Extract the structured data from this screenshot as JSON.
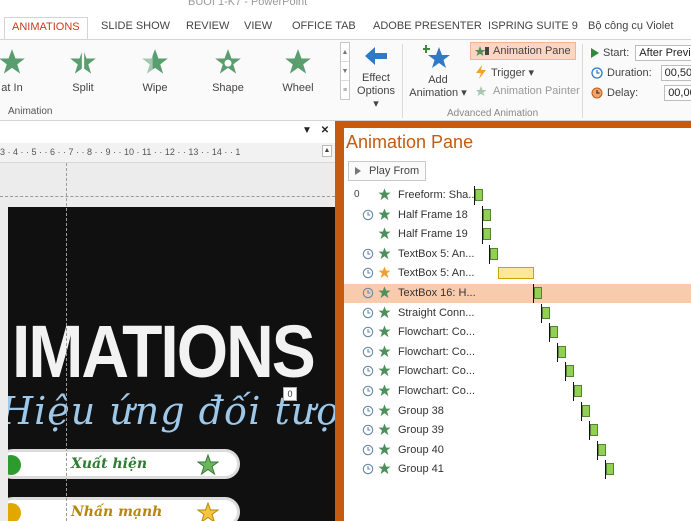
{
  "window": {
    "title": "BUOI 1-K7 - PowerPoint"
  },
  "ribbon_tabs": [
    {
      "label": "ANIMATIONS",
      "active": true
    },
    {
      "label": "SLIDE SHOW"
    },
    {
      "label": "REVIEW"
    },
    {
      "label": "VIEW"
    },
    {
      "label": "OFFICE TAB"
    },
    {
      "label": "ADOBE PRESENTER"
    },
    {
      "label": "ISPRING SUITE 9"
    },
    {
      "label": "Bộ công cụ Violet"
    }
  ],
  "animation_gallery": {
    "items": [
      {
        "label": "at In"
      },
      {
        "label": "Split"
      },
      {
        "label": "Wipe"
      },
      {
        "label": "Shape"
      },
      {
        "label": "Wheel"
      }
    ],
    "group_label": "Animation"
  },
  "effect_options": {
    "label_line1": "Effect",
    "label_line2": "Options ▾"
  },
  "add_animation": {
    "label_line1": "Add",
    "label_line2": "Animation ▾"
  },
  "advanced_animation": {
    "animation_pane": "Animation Pane",
    "trigger": "Trigger ▾",
    "animation_painter": "Animation Painter",
    "group_label": "Advanced Animation"
  },
  "timing": {
    "start_label": "Start:",
    "start_value": "After Previo",
    "duration_label": "Duration:",
    "duration_value": "00,50",
    "delay_label": "Delay:",
    "delay_value": "00,00"
  },
  "ruler": {
    "ticks": "3 · 4 · · 5 · · 6 · · 7 · · 8 · · 9 · · 10 · 11 · · 12 · · 13 · · 14 · · 1"
  },
  "slide": {
    "title": "IMATIONS",
    "subtitle": "Hiệu ứng đối tượng",
    "badge": "0",
    "pills": [
      {
        "label": "Xuất hiện",
        "color": "#2e7d32",
        "dot": "#2e9b2e"
      },
      {
        "label": "Nhấn mạnh",
        "color": "#b8860b",
        "dot": "#e0a800"
      }
    ]
  },
  "animation_pane": {
    "title": "Animation Pane",
    "play_label": "Play From",
    "items": [
      {
        "num": "0",
        "clock": false,
        "star": "#4e8f5c",
        "name": "Freeform: Sha...",
        "start": 0,
        "dur": 8,
        "selected": false
      },
      {
        "num": "",
        "clock": true,
        "star": "#4e8f5c",
        "name": "Half Frame 18",
        "start": 8,
        "dur": 8,
        "selected": false
      },
      {
        "num": "",
        "clock": false,
        "star": "#4e8f5c",
        "name": "Half Frame 19",
        "start": 8,
        "dur": 8,
        "selected": false
      },
      {
        "num": "",
        "clock": true,
        "star": "#4e8f5c",
        "name": "TextBox 5: An...",
        "start": 15,
        "dur": 8,
        "selected": false
      },
      {
        "num": "",
        "clock": true,
        "star": "#f0a030",
        "name": "TextBox 5: An...",
        "start": 23,
        "dur": 36,
        "selected": false,
        "yellow": true
      },
      {
        "num": "",
        "clock": true,
        "star": "#4e8f5c",
        "name": "TextBox 16: H...",
        "start": 59,
        "dur": 8,
        "selected": true
      },
      {
        "num": "",
        "clock": true,
        "star": "#4e8f5c",
        "name": "Straight Conn...",
        "start": 67,
        "dur": 8,
        "selected": false
      },
      {
        "num": "",
        "clock": true,
        "star": "#4e8f5c",
        "name": "Flowchart: Co...",
        "start": 75,
        "dur": 8,
        "selected": false
      },
      {
        "num": "",
        "clock": true,
        "star": "#4e8f5c",
        "name": "Flowchart: Co...",
        "start": 83,
        "dur": 8,
        "selected": false
      },
      {
        "num": "",
        "clock": true,
        "star": "#4e8f5c",
        "name": "Flowchart: Co...",
        "start": 91,
        "dur": 8,
        "selected": false
      },
      {
        "num": "",
        "clock": true,
        "star": "#4e8f5c",
        "name": "Flowchart: Co...",
        "start": 99,
        "dur": 8,
        "selected": false
      },
      {
        "num": "",
        "clock": true,
        "star": "#4e8f5c",
        "name": "Group 38",
        "start": 107,
        "dur": 8,
        "selected": false
      },
      {
        "num": "",
        "clock": true,
        "star": "#4e8f5c",
        "name": "Group 39",
        "start": 115,
        "dur": 8,
        "selected": false
      },
      {
        "num": "",
        "clock": true,
        "star": "#4e8f5c",
        "name": "Group 40",
        "start": 123,
        "dur": 8,
        "selected": false
      },
      {
        "num": "",
        "clock": true,
        "star": "#4e8f5c",
        "name": "Group 41",
        "start": 131,
        "dur": 8,
        "selected": false
      }
    ]
  }
}
